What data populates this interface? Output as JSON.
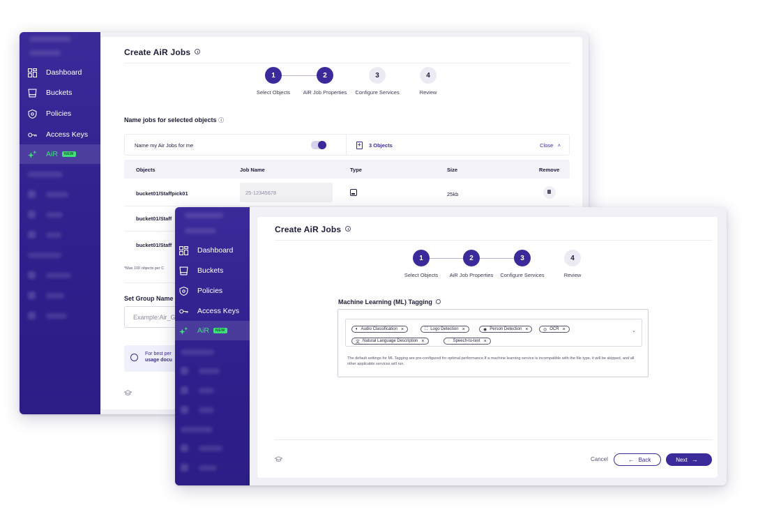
{
  "nav": {
    "items": [
      {
        "label": "Dashboard",
        "icon": "dashboard-icon"
      },
      {
        "label": "Buckets",
        "icon": "bucket-icon"
      },
      {
        "label": "Policies",
        "icon": "policy-shield-icon"
      },
      {
        "label": "Access Keys",
        "icon": "key-icon"
      },
      {
        "label": "AiR",
        "icon": "sparkle-icon",
        "badge": "NEW",
        "active": true
      }
    ]
  },
  "back_window": {
    "title": "Create AiR Jobs",
    "steps": [
      {
        "num": "1",
        "label": "Select Objects",
        "state": "done"
      },
      {
        "num": "2",
        "label": "AiR Job Properties",
        "state": "done"
      },
      {
        "num": "3",
        "label": "Configure Services",
        "state": "todo"
      },
      {
        "num": "4",
        "label": "Review",
        "state": "todo"
      }
    ],
    "name_jobs_heading": "Name jobs for selected objects",
    "name_toggle_label": "Name my Air Jobs for me",
    "toggle_on": true,
    "objects_count": "3 Objects",
    "close_label": "Close",
    "table": {
      "headers": [
        "Objects",
        "Job Name",
        "Type",
        "Size",
        "Remove"
      ],
      "rows": [
        {
          "object": "bucket01/Staffpick01",
          "job_name": "25-12345678",
          "size": "25kb"
        },
        {
          "object": "bucket01/Staff"
        },
        {
          "object": "bucket01/Staff"
        }
      ]
    },
    "max_note": "*Max 100 objects per C",
    "group_heading": "Set Group Name",
    "group_placeholder": "Example:Air_G",
    "tip_line1": "For best per",
    "tip_line2": "usage docu"
  },
  "front_window": {
    "title": "Create AiR Jobs",
    "steps": [
      {
        "num": "1",
        "label": "Select Objects",
        "state": "done"
      },
      {
        "num": "2",
        "label": "AiR Job Properties",
        "state": "done"
      },
      {
        "num": "3",
        "label": "Configure Services",
        "state": "done"
      },
      {
        "num": "4",
        "label": "Review",
        "state": "todo"
      }
    ],
    "ml_heading": "Machine Learning (ML) Tagging",
    "chips": [
      {
        "label": "Audio Classification",
        "glyph": "🔈︎"
      },
      {
        "label": "Logo Detection",
        "glyph": "⛶"
      },
      {
        "label": "Person Detection",
        "glyph": "◉"
      },
      {
        "label": "OCR",
        "glyph": "◎"
      },
      {
        "label": "Natural Language Description",
        "glyph": "文"
      },
      {
        "label": "Speech-to-text",
        "glyph": "◌"
      }
    ],
    "ml_note": "The default settings for ML Tagging are pre-configured for optimal performance.If a machine learning service is incompatible with the file type, it will be skipped, and all other applicable services will run.",
    "cancel_label": "Cancel",
    "back_label": "Back",
    "next_label": "Next"
  },
  "colors": {
    "brand": "#3b2a99",
    "accent_green": "#3ee07a"
  }
}
